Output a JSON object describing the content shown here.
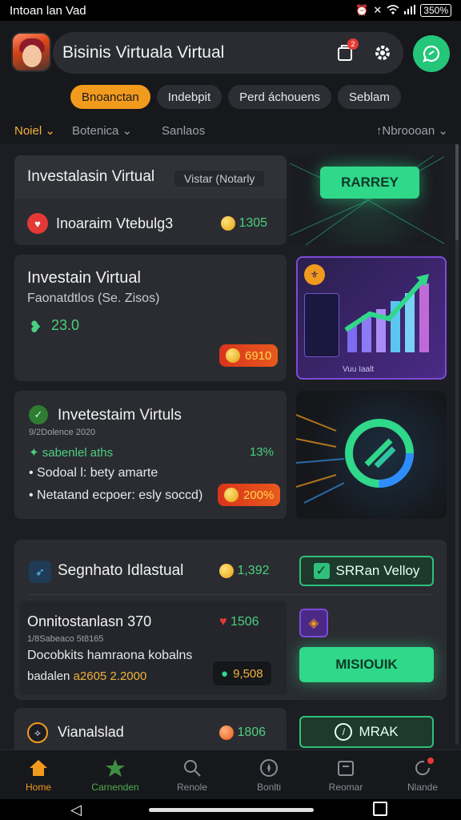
{
  "status_bar": {
    "left_text": "Intoan lan Vad",
    "battery": "350%",
    "icons": [
      "alarm-icon",
      "vibrate-icon",
      "wifi-icon",
      "signal-icon",
      "battery-icon"
    ]
  },
  "header": {
    "title": "Bisinis Virtuala Virtual",
    "notification_badge": "2",
    "chips": [
      "Bnoanctan",
      "Indebpit",
      "Perd áchouens",
      "Seblam"
    ],
    "filters": {
      "f1": "Noiel",
      "f2": "Botenica",
      "f3": "Sanlaos",
      "f4": "Nbroooan"
    }
  },
  "cards": {
    "c1": {
      "title": "Investalasin Virtual",
      "tag": "Vistar (Notarly",
      "sub_label": "Inoaraim Vtebulg3",
      "coins": "1305",
      "cta": "RARREY"
    },
    "c2": {
      "title": "Investain Virtual",
      "subtitle": "Faonatdtlos (Se. Zisos)",
      "value": "23.0",
      "badge": "6910",
      "image_caption": "Vuu   Iaalt"
    },
    "c3": {
      "title": "Invetestaim Virtuls",
      "date": "9/2Dolence 2020",
      "line1": "sabenlel aths",
      "line1_pct": "13%",
      "bullet1": "Sodoal l: bety amarte",
      "bullet2": "Netatand ecpoer: esly soccd)",
      "badge": "200%"
    },
    "c4": {
      "title": "Segnhato Idlastual",
      "coins": "1,392",
      "cta": "SRRan Velloy",
      "sub_title": "Onnitostanlasn 370",
      "sub_coins": "1506",
      "sub_meta": "1/8Sabeaco 5t8165",
      "desc1": "Docobkits hamraona kobalns",
      "desc2_label": "badalen",
      "desc2_value": "a2605 2.2000",
      "stat": "9,508",
      "cta2": "MISIOUIK"
    },
    "c5": {
      "title": "Vianalslad",
      "coins": "1806",
      "cta": "MRAK"
    }
  },
  "bottom_nav": [
    "Home",
    "Carnenden",
    "Renole",
    "Bonlti",
    "Reomar",
    "Nlande"
  ]
}
